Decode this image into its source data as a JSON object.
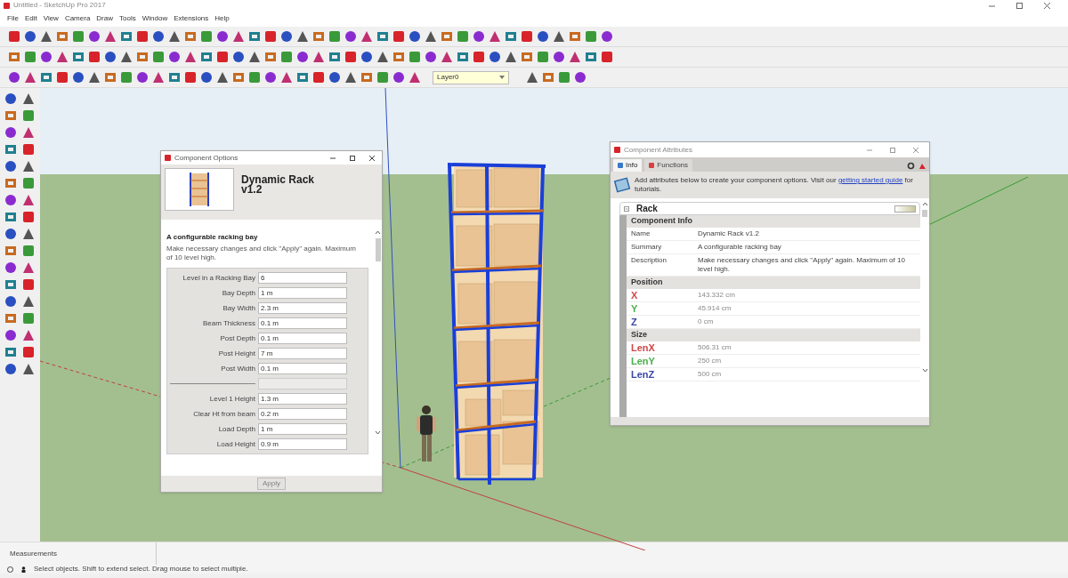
{
  "window": {
    "title": "Untitled - SketchUp Pro 2017"
  },
  "menu": [
    "File",
    "Edit",
    "View",
    "Camera",
    "Draw",
    "Tools",
    "Window",
    "Extensions",
    "Help"
  ],
  "layer_dropdown": {
    "value": "Layer0"
  },
  "options_dialog": {
    "title": "Component Options",
    "component_name": "Dynamic Rack v1.2",
    "heading": "A configurable racking bay",
    "description": "Make necessary changes and click \"Apply\" again. Maximum of 10 level high.",
    "fields": [
      {
        "kind": "field",
        "label": "Level in a Racking Bay",
        "value": "6"
      },
      {
        "kind": "field",
        "label": "Bay Depth",
        "value": "1 m"
      },
      {
        "kind": "field",
        "label": "Bay Width",
        "value": "2.3 m"
      },
      {
        "kind": "field",
        "label": "Beam Thickness",
        "value": "0.1 m"
      },
      {
        "kind": "field",
        "label": "Post Depth",
        "value": "0.1 m"
      },
      {
        "kind": "field",
        "label": "Post Height",
        "value": "7 m"
      },
      {
        "kind": "field",
        "label": "Post Width",
        "value": "0.1 m"
      },
      {
        "kind": "separator"
      },
      {
        "kind": "field",
        "label": "Level 1 Height",
        "value": "1.3 m"
      },
      {
        "kind": "field",
        "label": "Clear Ht from beam",
        "value": "0.2 m"
      },
      {
        "kind": "field",
        "label": "Load Depth",
        "value": "1 m"
      },
      {
        "kind": "field",
        "label": "Load Height",
        "value": "0.9 m"
      }
    ],
    "apply_button": {
      "label": "Apply",
      "disabled": true
    }
  },
  "attributes_dialog": {
    "title": "Component Attributes",
    "tabs": [
      {
        "label": "Info",
        "selected": true
      },
      {
        "label": "Functions",
        "selected": false
      }
    ],
    "intro_before": "Add attributes below to create your component options. Visit our",
    "intro_link": "getting started guide",
    "intro_after": "for tutorials.",
    "component": "Rack",
    "sections": [
      {
        "title": "Component Info",
        "rows": [
          {
            "name": "Name",
            "value": "Dynamic Rack v1.2"
          },
          {
            "name": "Summary",
            "value": "A configurable racking bay"
          },
          {
            "name": "Description",
            "value": "Make necessary changes and click \"Apply\" again. Maximum of 10 level high."
          }
        ]
      },
      {
        "title": "Position",
        "rows": [
          {
            "name": "X",
            "value": "143.332 cm",
            "color": "#d04848"
          },
          {
            "name": "Y",
            "value": "45.914 cm",
            "color": "#48b048"
          },
          {
            "name": "Z",
            "value": "0 cm",
            "color": "#3848a8"
          }
        ]
      },
      {
        "title": "Size",
        "rows": [
          {
            "name": "LenX",
            "value": "506.31 cm",
            "color": "#d04848"
          },
          {
            "name": "LenY",
            "value": "250 cm",
            "color": "#48b048"
          },
          {
            "name": "LenZ",
            "value": "500 cm",
            "color": "#3848a8"
          }
        ]
      }
    ]
  },
  "measurements": {
    "label": "Measurements"
  },
  "status_bar": {
    "hint": "Select objects. Shift to extend select. Drag mouse to select multiple."
  }
}
